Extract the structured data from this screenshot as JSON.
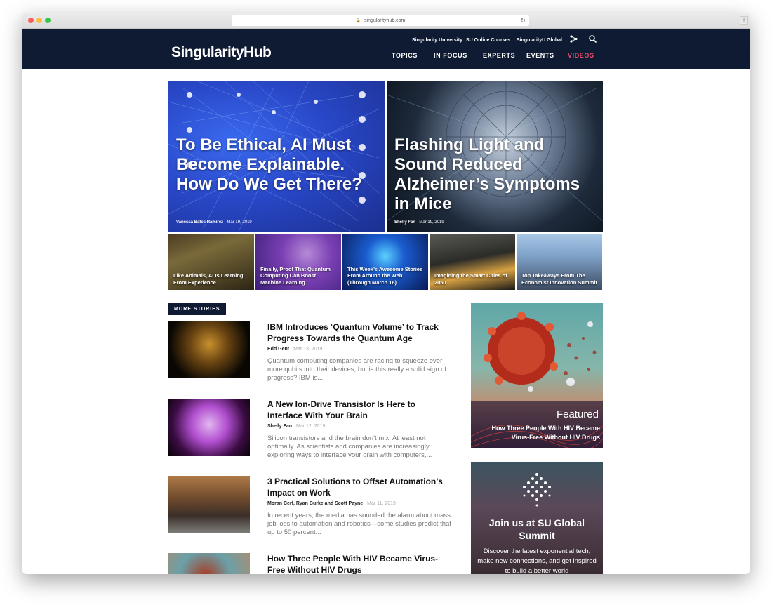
{
  "browser": {
    "url": "singularityhub.com",
    "new_tab": "+"
  },
  "header": {
    "logo": "SingularityHub",
    "utility_links": [
      "Singularity University",
      "SU Online Courses",
      "SingularityU Global"
    ],
    "nav": [
      "TOPICS",
      "IN FOCUS",
      "EXPERTS",
      "EVENTS",
      "VIDEOS"
    ]
  },
  "hero": [
    {
      "title": "To Be Ethical, AI Must Become Explainable. How Do We Get There?",
      "author": "Vanessa Bates Ramirez",
      "date": "Mar 19, 2019"
    },
    {
      "title": "Flashing Light and Sound Reduced Alzheimer’s Symptoms in Mice",
      "author": "Shelly Fan",
      "date": "Mar 19, 2019"
    }
  ],
  "tiles": [
    {
      "title": "Like Animals, AI Is Learning From Experience"
    },
    {
      "title": "Finally, Proof That Quantum Computing Can Boost Machine Learning"
    },
    {
      "title": "This Week’s Awesome Stories From Around the Web (Through March 16)"
    },
    {
      "title": "Imagining the Smart Cities of 2050"
    },
    {
      "title": "Top Takeaways From The Economist Innovation Summit"
    }
  ],
  "more_stories": {
    "label": "MORE STORIES",
    "items": [
      {
        "title": "IBM Introduces ‘Quantum Volume’ to Track Progress Towards the Quantum Age",
        "author": "Edd Gent",
        "date": "Mar 13, 2019",
        "excerpt": "Quantum computing companies are racing to squeeze ever more qubits into their devices, but is this really a solid sign of progress? IBM is..."
      },
      {
        "title": "A New Ion-Drive Transistor Is Here to Interface With Your Brain",
        "author": "Shelly Fan",
        "date": "Mar 12, 2019",
        "excerpt": "Silicon transistors and the brain don’t mix. At least not optimally. As scientists and companies are increasingly exploring ways to interface your brain with computers,..."
      },
      {
        "title": "3 Practical Solutions to Offset Automation’s Impact on Work",
        "author": "Moran Cerf, Ryan Burke and Scott Payne",
        "date": "Mar 11, 2019",
        "excerpt": "In recent years, the media has sounded the alarm about mass job loss to automation and robotics—some studies predict that up to 50 percent..."
      },
      {
        "title": "How Three People With HIV Became Virus-Free Without HIV Drugs",
        "author": "",
        "date": "",
        "excerpt": ""
      }
    ]
  },
  "sidebar": {
    "featured_label": "Featured",
    "featured_title": "How Three People With HIV Became Virus-Free Without HIV Drugs",
    "summit_title": "Join us at SU Global Summit",
    "summit_text": "Discover the latest exponential tech, make new connections, and get inspired to build a better world"
  }
}
